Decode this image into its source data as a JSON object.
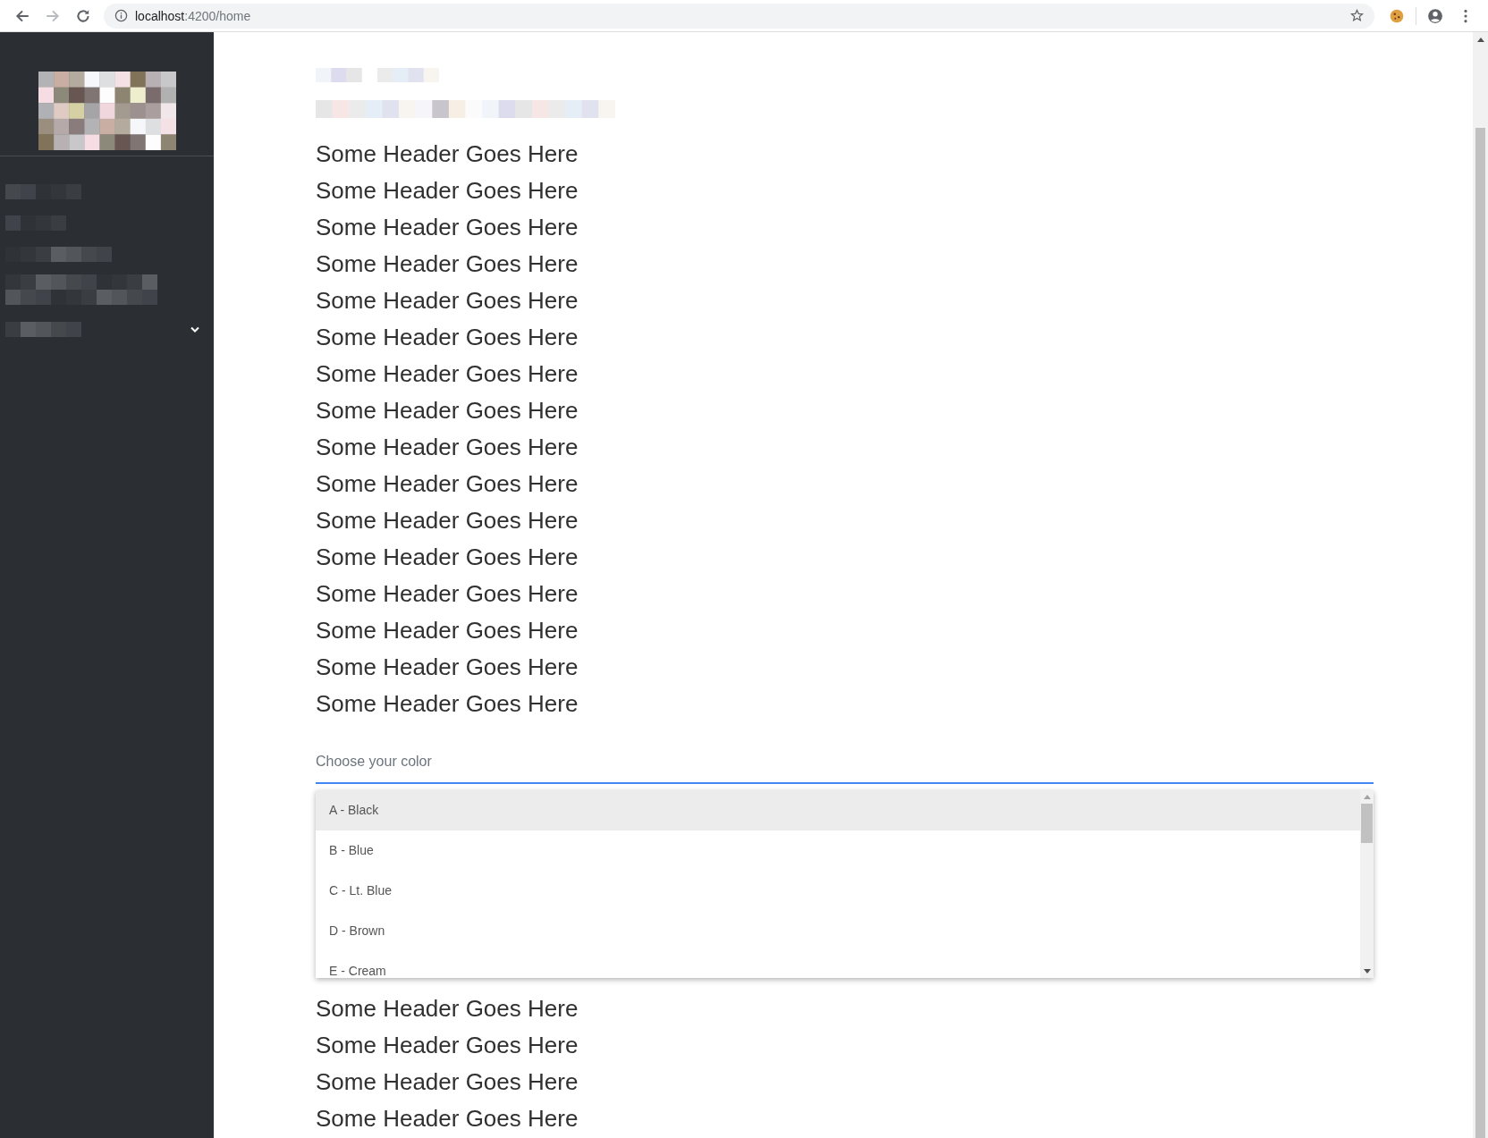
{
  "browser": {
    "url_host": "localhost",
    "url_path": ":4200/home",
    "forward_disabled": true
  },
  "sidebar": {
    "items": [
      {
        "expandable": false
      },
      {
        "expandable": false
      },
      {
        "expandable": false
      },
      {
        "expandable": false
      },
      {
        "expandable": true
      }
    ]
  },
  "headers_above": [
    "Some Header Goes Here",
    "Some Header Goes Here",
    "Some Header Goes Here",
    "Some Header Goes Here",
    "Some Header Goes Here",
    "Some Header Goes Here",
    "Some Header Goes Here",
    "Some Header Goes Here",
    "Some Header Goes Here",
    "Some Header Goes Here",
    "Some Header Goes Here",
    "Some Header Goes Here",
    "Some Header Goes Here",
    "Some Header Goes Here",
    "Some Header Goes Here",
    "Some Header Goes Here"
  ],
  "color_select": {
    "placeholder": "Choose your color",
    "focused": true,
    "options": [
      {
        "label": "A - Black",
        "selected": true
      },
      {
        "label": "B - Blue",
        "selected": false
      },
      {
        "label": "C - Lt. Blue",
        "selected": false
      },
      {
        "label": "D - Brown",
        "selected": false
      },
      {
        "label": "E - Cream",
        "selected": false
      }
    ]
  },
  "headers_below": [
    "Some Header Goes Here",
    "Some Header Goes Here",
    "Some Header Goes Here",
    "Some Header Goes Here"
  ]
}
